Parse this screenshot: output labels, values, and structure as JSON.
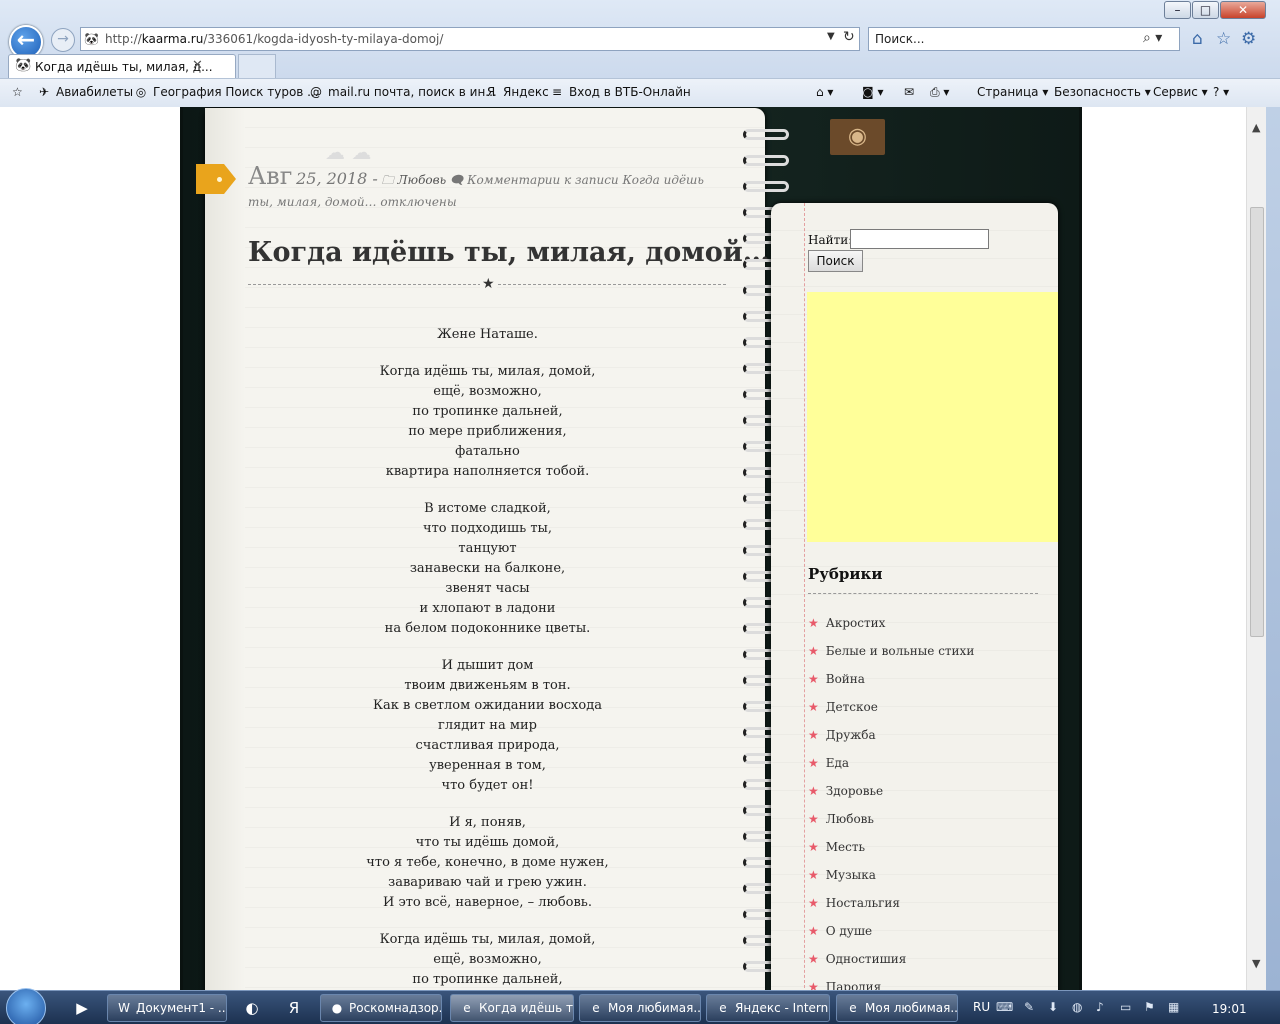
{
  "window": {
    "min": "–",
    "max": "□",
    "close": "✕"
  },
  "nav": {
    "back": "←",
    "forward": "→",
    "url_prefix": "http://",
    "url_domain": "kaarma.ru",
    "url_path": "/336061/kogda-idyosh-ty-milaya-domoj/",
    "search_placeholder": "Поиск...",
    "favicon": "🐼"
  },
  "tab": {
    "title": "Когда идёшь ты, милая, д...",
    "close": "✕"
  },
  "favorites": [
    {
      "icon": "✈",
      "label": "Авиабилеты"
    },
    {
      "icon": "◎",
      "label": "География Поиск туров ..."
    },
    {
      "icon": "@",
      "label": "mail.ru почта, поиск в ин..."
    },
    {
      "icon": "Я",
      "label": "Яндекс"
    },
    {
      "icon": "≡",
      "label": "Вход в ВТБ-Онлайн"
    }
  ],
  "commandbar": {
    "page": "Страница ▾",
    "safety": "Безопасность ▾",
    "tools": "Сервис ▾"
  },
  "post": {
    "month": "Авг",
    "day": "25, 2018 -",
    "category": "Любовь",
    "comments": "Комментарии к записи Когда идёшь ты, милая, домой… отключены",
    "title": "Когда идёшь ты, милая, домой…",
    "dedication": "Жене Наташе.",
    "stanzas": [
      [
        "Когда идёшь ты, милая, домой,",
        "ещё, возможно,",
        "по тропинке дальней,",
        "по мере приближения,",
        "фатально",
        "квартира наполняется тобой."
      ],
      [
        "В истоме сладкой,",
        "что подходишь ты,",
        "танцуют",
        "занавески на балконе,",
        "звенят часы",
        "и хлопают в ладони",
        "на белом подоконнике цветы."
      ],
      [
        "И дышит дом",
        "твоим движеньям в тон.",
        "Как в светлом ожидании восхода",
        "глядит на мир",
        "счастливая природа,",
        "уверенная в том,",
        "что будет он!"
      ],
      [
        "И я, поняв,",
        "что ты идёшь домой,",
        "что я тебе, конечно, в доме нужен,",
        "завариваю чай и грею ужин.",
        "И это всё, наверное, – любовь."
      ],
      [
        "Когда идёшь ты, милая, домой,",
        "ещё, возможно,",
        "по тропинке дальней,"
      ]
    ]
  },
  "sidebar": {
    "find_label": "Найти:",
    "find_button": "Поиск",
    "rubrics_title": "Рубрики",
    "categories": [
      "Акростих",
      "Белые и вольные стихи",
      "Война",
      "Детское",
      "Дружба",
      "Еда",
      "Здоровье",
      "Любовь",
      "Месть",
      "Музыка",
      "Ностальгия",
      "О душе",
      "Одностишия",
      "Пародия"
    ]
  },
  "taskbar": {
    "items": [
      {
        "icon": "W",
        "label": "Документ1 - ..."
      },
      {
        "icon": "●",
        "label": "Роскомнадзор..."
      },
      {
        "icon": "e",
        "label": "Когда идёшь т..."
      },
      {
        "icon": "e",
        "label": "Моя любимая..."
      },
      {
        "icon": "e",
        "label": "Яндекс - Intern..."
      },
      {
        "icon": "e",
        "label": "Моя любимая..."
      }
    ],
    "lang": "RU",
    "time": "19:01"
  },
  "colors": {
    "accent": "#e9a41c",
    "board": "#162722",
    "ad": "#ffff99",
    "star": "#e85a6a"
  }
}
